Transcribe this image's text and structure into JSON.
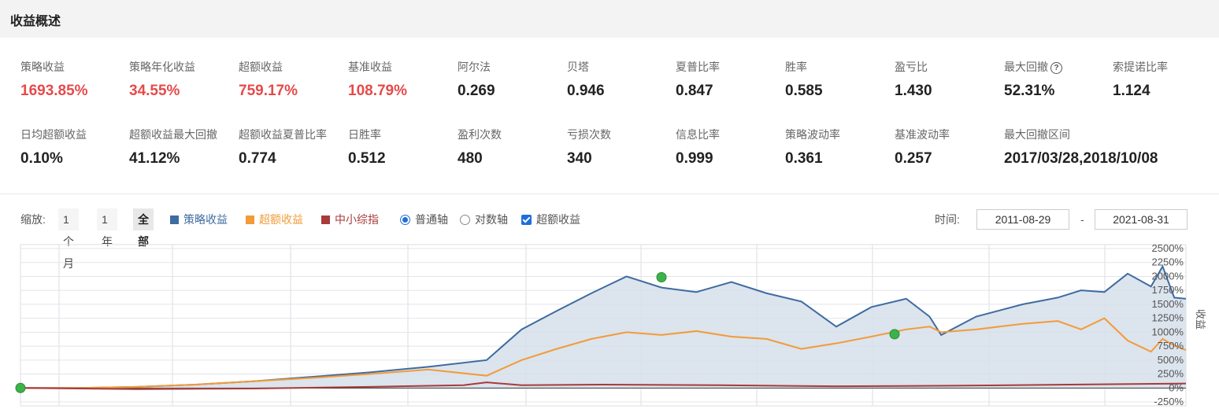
{
  "header": {
    "title": "收益概述"
  },
  "metrics": [
    {
      "label": "策略收益",
      "value": "1693.85%",
      "red": true
    },
    {
      "label": "策略年化收益",
      "value": "34.55%",
      "red": true
    },
    {
      "label": "超额收益",
      "value": "759.17%",
      "red": true
    },
    {
      "label": "基准收益",
      "value": "108.79%",
      "red": true
    },
    {
      "label": "阿尔法",
      "value": "0.269"
    },
    {
      "label": "贝塔",
      "value": "0.946"
    },
    {
      "label": "夏普比率",
      "value": "0.847"
    },
    {
      "label": "胜率",
      "value": "0.585"
    },
    {
      "label": "盈亏比",
      "value": "1.430"
    },
    {
      "label": "最大回撤",
      "value": "52.31%",
      "help": true
    },
    {
      "label": "索提诺比率",
      "value": "1.124"
    },
    {
      "label": "日均超额收益",
      "value": "0.10%"
    },
    {
      "label": "超额收益最大回撤",
      "value": "41.12%"
    },
    {
      "label": "超额收益夏普比率",
      "value": "0.774"
    },
    {
      "label": "日胜率",
      "value": "0.512"
    },
    {
      "label": "盈利次数",
      "value": "480"
    },
    {
      "label": "亏损次数",
      "value": "340"
    },
    {
      "label": "信息比率",
      "value": "0.999"
    },
    {
      "label": "策略波动率",
      "value": "0.361"
    },
    {
      "label": "基准波动率",
      "value": "0.257"
    },
    {
      "label": "最大回撤区间",
      "value": "2017/03/28,2018/10/08"
    }
  ],
  "help_icon": {
    "glyph": "?"
  },
  "toolbar": {
    "zoom_label": "缩放:",
    "zoom_options": [
      "1个月",
      "1年",
      "全部"
    ],
    "series_toggles": [
      {
        "label": "策略收益",
        "color": "#3f6ba0"
      },
      {
        "label": "超额收益",
        "color": "#f29b38"
      },
      {
        "label": "中小综指",
        "color": "#a83a3a"
      }
    ],
    "axis_options": [
      {
        "label": "普通轴",
        "checked": true
      },
      {
        "label": "对数轴",
        "checked": false
      }
    ],
    "excess_checkbox": {
      "label": "超额收益",
      "checked": true
    },
    "time_label": "时间:",
    "date_from": "2011-08-29",
    "date_separator": "-",
    "date_to": "2021-08-31"
  },
  "chart_data": {
    "type": "line",
    "ylabel": "收益",
    "y_ticks": [
      "2500%",
      "2250%",
      "2000%",
      "1750%",
      "1500%",
      "1250%",
      "1000%",
      "750%",
      "500%",
      "250%",
      "0%",
      "-250%"
    ],
    "ylim": [
      -250,
      2500
    ],
    "xlim": [
      0,
      10
    ],
    "series": [
      {
        "name": "策略收益",
        "color": "#3f6ba0",
        "area": true,
        "x": [
          0,
          0.5,
          1,
          1.5,
          2,
          2.5,
          3,
          3.5,
          4,
          4.3,
          4.6,
          4.9,
          5.2,
          5.5,
          5.8,
          6.1,
          6.4,
          6.7,
          7,
          7.3,
          7.6,
          7.8,
          7.9,
          8.2,
          8.6,
          8.9,
          9.1,
          9.3,
          9.5,
          9.7,
          9.8,
          9.9,
          10
        ],
        "y": [
          0,
          0,
          20,
          60,
          120,
          200,
          280,
          380,
          500,
          1050,
          1380,
          1700,
          2000,
          1800,
          1720,
          1900,
          1700,
          1550,
          1100,
          1450,
          1600,
          1280,
          950,
          1280,
          1500,
          1620,
          1750,
          1720,
          2050,
          1820,
          2180,
          1620,
          1600
        ]
      },
      {
        "name": "超额收益",
        "color": "#f29b38",
        "x": [
          0,
          0.5,
          1,
          1.5,
          2,
          2.5,
          3,
          3.5,
          4,
          4.3,
          4.6,
          4.9,
          5.2,
          5.5,
          5.8,
          6.1,
          6.4,
          6.7,
          7,
          7.3,
          7.6,
          7.8,
          7.9,
          8.2,
          8.6,
          8.9,
          9.1,
          9.3,
          9.5,
          9.7,
          9.8,
          9.9,
          10
        ],
        "y": [
          0,
          0,
          20,
          60,
          120,
          180,
          250,
          330,
          220,
          500,
          700,
          880,
          1000,
          950,
          1020,
          920,
          880,
          700,
          800,
          920,
          1050,
          1100,
          1000,
          1050,
          1150,
          1200,
          1050,
          1250,
          850,
          650,
          880,
          760,
          680
        ]
      },
      {
        "name": "中小综指",
        "color": "#a83a3a",
        "x": [
          0,
          1,
          2,
          3,
          3.8,
          4,
          4.3,
          5,
          6,
          7,
          8,
          9,
          10
        ],
        "y": [
          0,
          -20,
          -10,
          20,
          50,
          100,
          50,
          60,
          50,
          30,
          40,
          60,
          80
        ]
      }
    ],
    "markers": [
      {
        "x": 0,
        "y": 0,
        "color": "#3cb34a"
      },
      {
        "x": 5.5,
        "y": 1985,
        "color": "#3cb34a"
      },
      {
        "x": 7.5,
        "y": 965,
        "color": "#3cb34a"
      }
    ]
  }
}
